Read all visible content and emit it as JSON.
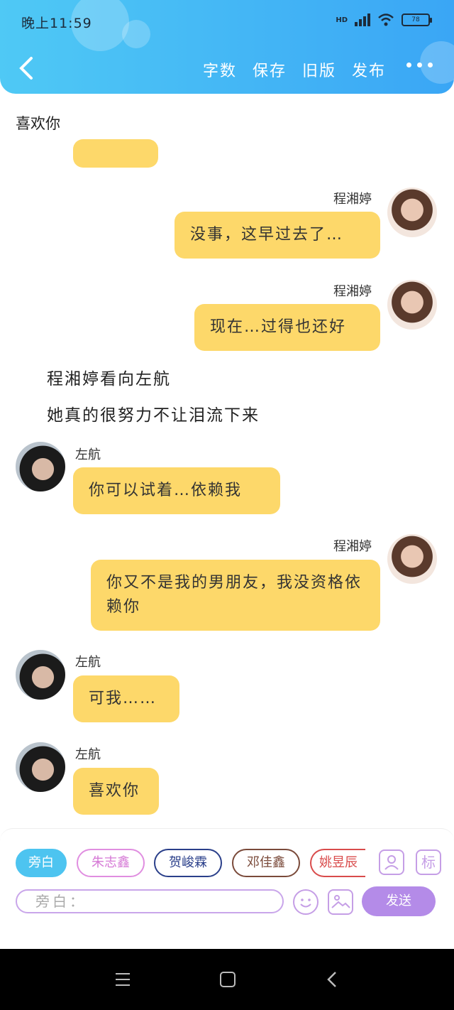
{
  "status_bar": {
    "time": "晚上11:59",
    "network": "HD",
    "battery": "78"
  },
  "header": {
    "actions": [
      "字数",
      "保存",
      "旧版",
      "发布"
    ]
  },
  "chat_title": "喜欢你",
  "messages": [
    {
      "speaker": "程湘婷",
      "text": "没事，这早过去了…"
    },
    {
      "speaker": "程湘婷",
      "text": "现在…过得也还好"
    },
    {
      "narration": "程湘婷看向左航"
    },
    {
      "narration": "她真的很努力不让泪流下来"
    },
    {
      "speaker": "左航",
      "text": "你可以试着…依赖我"
    },
    {
      "speaker": "程湘婷",
      "text": "你又不是我的男朋友，我没资格依赖你"
    },
    {
      "speaker": "左航",
      "text": "可我……"
    },
    {
      "speaker": "左航",
      "text": "喜欢你"
    }
  ],
  "characters": [
    "旁白",
    "朱志鑫",
    "贺峻霖",
    "邓佳鑫",
    "姚昱辰"
  ],
  "input": {
    "placeholder": "旁白："
  },
  "send_label": "发送",
  "tools": {
    "mark_label": "标"
  },
  "colors": {
    "header": "#3aa6f5",
    "bubble": "#fdd86a",
    "accent": "#b48be8"
  }
}
